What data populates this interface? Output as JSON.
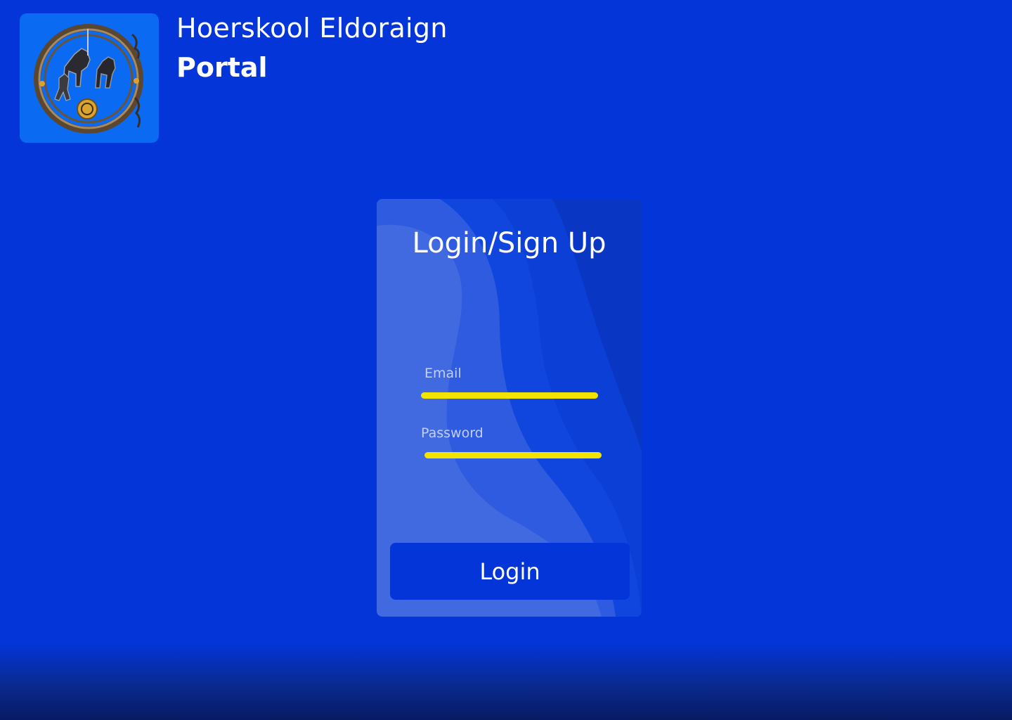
{
  "header": {
    "brand_name": "Hoerskool Eldoraign",
    "brand_sub": "Portal",
    "logo_icon": "chariot-crest-icon"
  },
  "login": {
    "title": "Login/Sign Up",
    "email_label": "Email",
    "email_value": "",
    "password_label": "Password",
    "password_value": "",
    "button_label": "Login"
  },
  "colors": {
    "background": "#0335d8",
    "card": "#4169e0",
    "input_underline": "#f2e400",
    "button": "#0335d8",
    "logo_tile": "#0a6bf2"
  }
}
